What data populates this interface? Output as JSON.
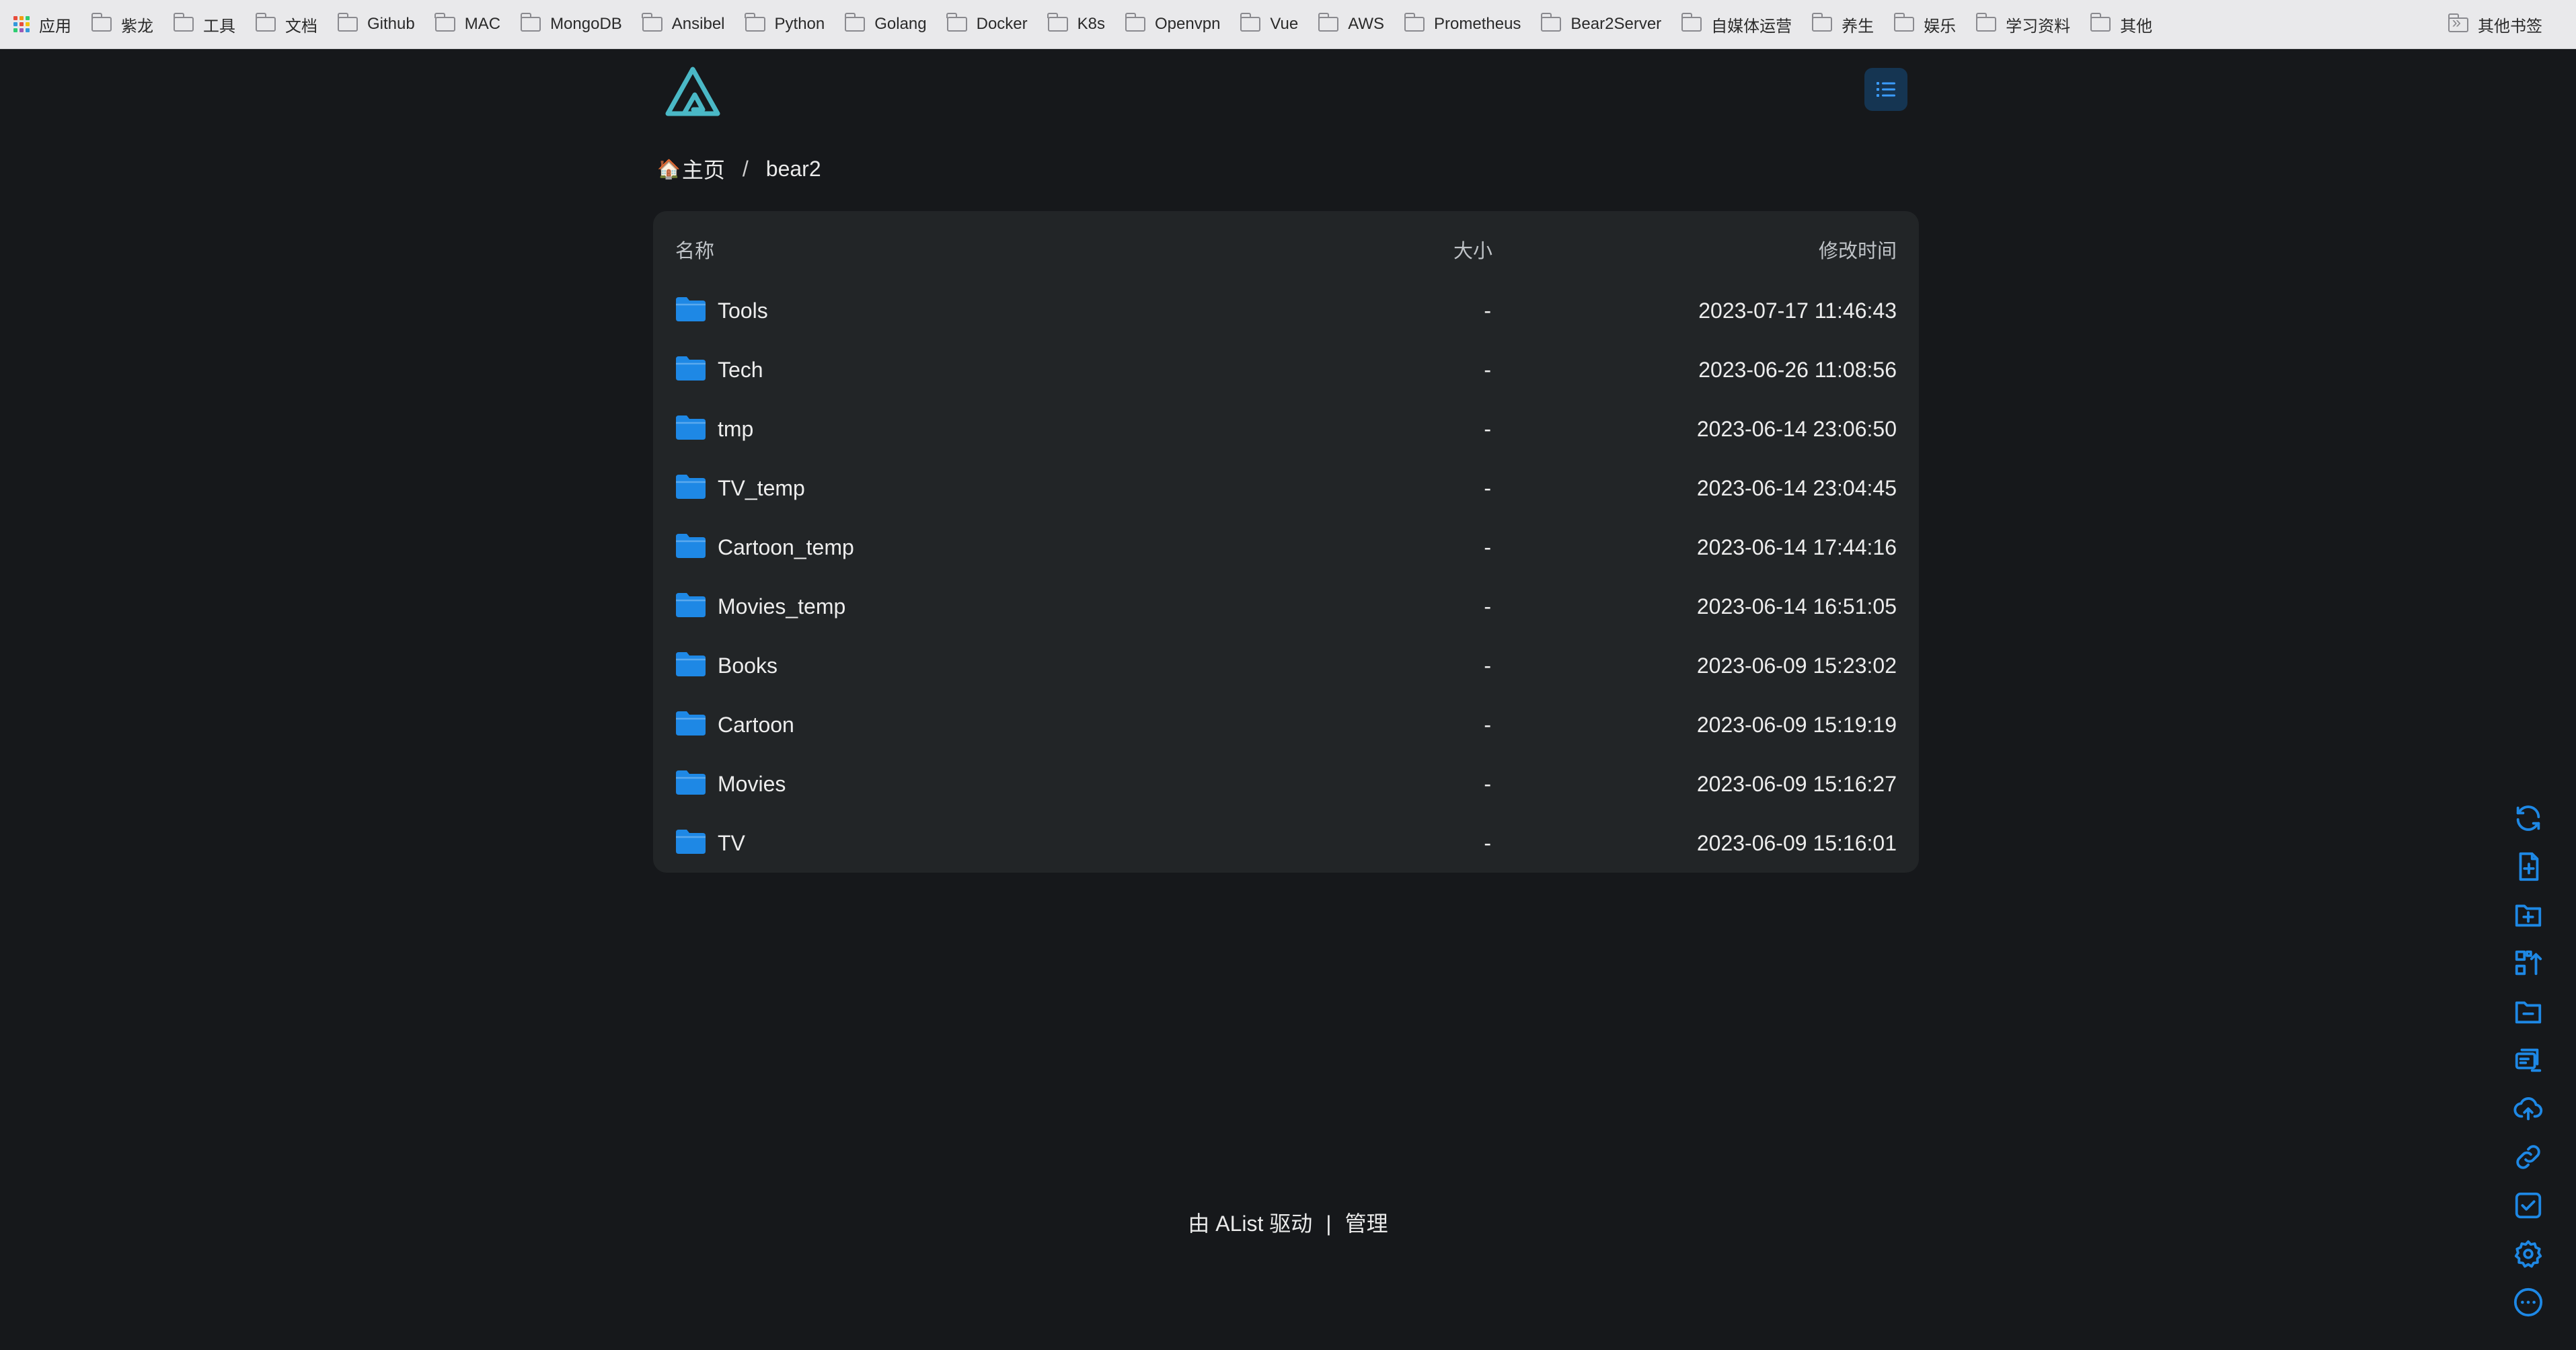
{
  "bookmarks": {
    "apps_label": "应用",
    "folders": [
      "紫龙",
      "工具",
      "文档",
      "Github",
      "MAC",
      "MongoDB",
      "Ansibel",
      "Python",
      "Golang",
      "Docker",
      "K8s",
      "Openvpn",
      "Vue",
      "AWS",
      "Prometheus",
      "Bear2Server",
      "自媒体运营",
      "养生",
      "娱乐",
      "学习资料",
      "其他"
    ],
    "more_glyph": "»",
    "other_label": "其他书签"
  },
  "breadcrumb": {
    "home_emoji": "🏠",
    "home": "主页",
    "separator": "/",
    "current": "bear2"
  },
  "table": {
    "headers": {
      "name": "名称",
      "size": "大小",
      "modified": "修改时间"
    },
    "rows": [
      {
        "name": "Tools",
        "size": "-",
        "modified": "2023-07-17 11:46:43"
      },
      {
        "name": "Tech",
        "size": "-",
        "modified": "2023-06-26 11:08:56"
      },
      {
        "name": "tmp",
        "size": "-",
        "modified": "2023-06-14 23:06:50"
      },
      {
        "name": "TV_temp",
        "size": "-",
        "modified": "2023-06-14 23:04:45"
      },
      {
        "name": "Cartoon_temp",
        "size": "-",
        "modified": "2023-06-14 17:44:16"
      },
      {
        "name": "Movies_temp",
        "size": "-",
        "modified": "2023-06-14 16:51:05"
      },
      {
        "name": "Books",
        "size": "-",
        "modified": "2023-06-09 15:23:02"
      },
      {
        "name": "Cartoon",
        "size": "-",
        "modified": "2023-06-09 15:19:19"
      },
      {
        "name": "Movies",
        "size": "-",
        "modified": "2023-06-09 15:16:27"
      },
      {
        "name": "TV",
        "size": "-",
        "modified": "2023-06-09 15:16:01"
      }
    ]
  },
  "footer": {
    "powered": "由 AList 驱动",
    "separator": "|",
    "manage": "管理"
  },
  "toolbar_icons": [
    "refresh-icon",
    "new-file-icon",
    "new-folder-icon",
    "recursive-move-icon",
    "remove-empty-folder-icon",
    "batch-rename-icon",
    "upload-icon",
    "offline-download-icon",
    "select-icon",
    "settings-icon",
    "more-icon"
  ],
  "colors": {
    "accent": "#1e88e5",
    "background": "#16181b",
    "card": "#222527",
    "logo": "#4ab8c6"
  }
}
